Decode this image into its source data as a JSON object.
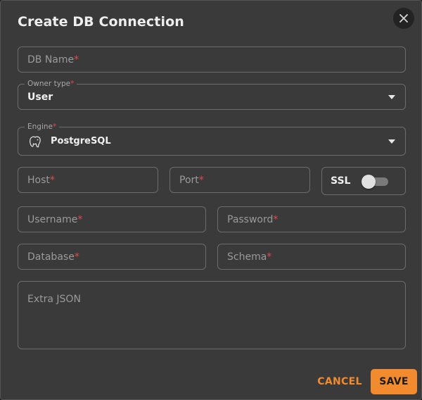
{
  "dialog": {
    "title": "Create DB Connection",
    "close_icon": "close-icon"
  },
  "form": {
    "db_name": {
      "placeholder": "DB Name",
      "required_mark": "*"
    },
    "owner_type": {
      "label": "Owner type",
      "required_mark": "*",
      "value": "User"
    },
    "engine": {
      "label": "Engine",
      "required_mark": "*",
      "value": "PostgreSQL",
      "icon": "postgresql-elephant-icon"
    },
    "host": {
      "placeholder": "Host",
      "required_mark": "*"
    },
    "port": {
      "placeholder": "Port",
      "required_mark": "*"
    },
    "ssl": {
      "label": "SSL",
      "enabled": false
    },
    "username": {
      "placeholder": "Username",
      "required_mark": "*"
    },
    "password": {
      "placeholder": "Password",
      "required_mark": "*"
    },
    "database": {
      "placeholder": "Database",
      "required_mark": "*"
    },
    "schema": {
      "placeholder": "Schema",
      "required_mark": "*"
    },
    "extra_json": {
      "placeholder": "Extra JSON"
    }
  },
  "actions": {
    "cancel_label": "CANCEL",
    "save_label": "SAVE"
  },
  "colors": {
    "accent": "#f28a2e",
    "required": "#e5484d",
    "background": "#3a3a3a"
  }
}
